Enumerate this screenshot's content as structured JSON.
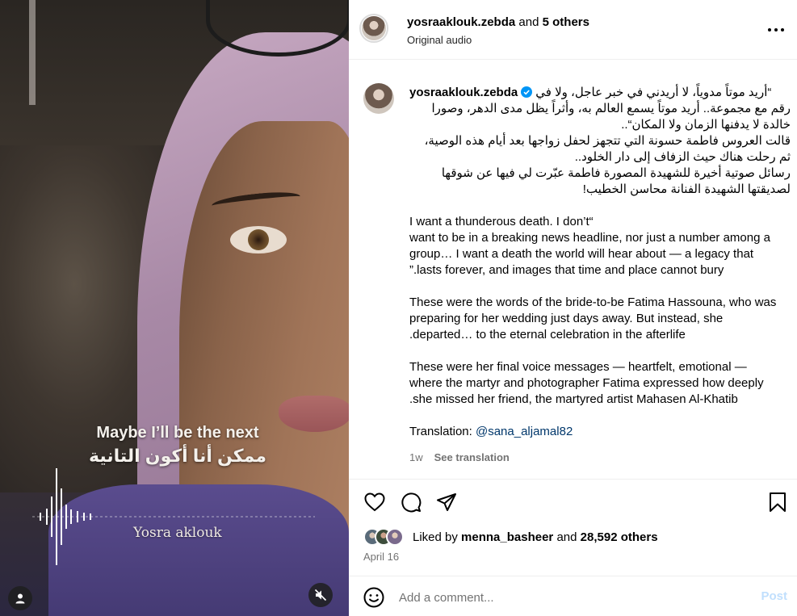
{
  "media": {
    "caption_en": "Maybe I’ll be the next",
    "caption_ar": "ممكن أنا أكون التانية",
    "signature": "Yosra aklouk",
    "icons": {
      "user_tag": "user-icon",
      "mute": "muted-speaker-icon"
    }
  },
  "header": {
    "username": "yosraaklouk.zebda",
    "and_text": "and",
    "others": "5 others",
    "audio": "Original audio",
    "more_icon": "more-horizontal-icon"
  },
  "caption": {
    "username": "yosraaklouk.zebda",
    "arabic_lines": [
      "“أريد موتاً مدوياً، لا أريدني في خبر عاجل، ولا في",
      "رقم مع مجموعة.. أريد موتاً يسمع العالم به، وأثراً يظل مدى الدهر، وصورا",
      "خالدة لا يدفنها الزمان ولا المكان“..",
      "قالت العروس فاطمة حسونة التي تتجهز لحفل زواجها بعد أيام هذه الوصية،",
      "ثم رحلت هناك حيث الزفاف إلى دار الخلود..",
      "رسائل صوتية أخيرة للشهيدة المصورة فاطمة عبّرت لي فيها عن شوقها",
      "لصديقتها الشهيدة الفنانة محاسن الخطيب!"
    ],
    "english_paragraphs": [
      [
        "I want a thunderous death. I don’t“",
        "want to be in a breaking news headline, nor just a number among a",
        "group… I want a death the world will hear about — a legacy that",
        "”.lasts forever, and images that time and place cannot bury"
      ],
      [
        "These were the words of the bride-to-be Fatima Hassouna, who was",
        "preparing for her wedding just days away. But instead, she",
        ".departed… to the eternal celebration in the afterlife"
      ],
      [
        "These were her final voice messages — heartfelt, emotional —",
        "where the martyr and photographer Fatima expressed how deeply",
        ".she missed her friend, the martyred artist Mahasen Al-Khatib"
      ]
    ],
    "translation_label": "Translation:",
    "translation_mention": "@sana_aljamal82",
    "time": "1w",
    "see_translation": "See translation"
  },
  "actions": {
    "icons": [
      "heart-icon",
      "comment-icon",
      "share-icon",
      "bookmark-icon"
    ],
    "liked_by": "Liked by",
    "liker": "menna_basheer",
    "and_text": "and",
    "others": "28,592 others",
    "date": "April 16"
  },
  "add_comment": {
    "placeholder": "Add a comment...",
    "post_label": "Post"
  },
  "colors": {
    "link": "#00376b",
    "muted": "#737373",
    "post_disabled": "#c0dffd",
    "verified": "#0095f6",
    "border": "#efefef"
  }
}
